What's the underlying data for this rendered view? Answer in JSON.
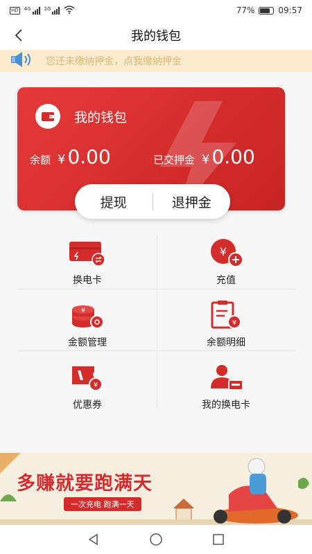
{
  "status_bar": {
    "network_labels": [
      "4G",
      "2G"
    ],
    "battery": "77%",
    "time": "09:57"
  },
  "header": {
    "title": "我的钱包",
    "back_icon": "chevron-left-icon"
  },
  "notice": {
    "text": "您还未缴纳押金，点我缴纳押金",
    "icon": "speaker-icon"
  },
  "wallet": {
    "title": "我的钱包",
    "balance_label": "余额",
    "balance_currency": "¥",
    "balance_value": "0.00",
    "deposit_label": "已交押金",
    "deposit_currency": "¥",
    "deposit_value": "0.00",
    "withdraw_label": "提现",
    "refund_deposit_label": "退押金"
  },
  "menu": {
    "items": [
      {
        "label": "换电卡",
        "icon": "battery-swap-card-icon"
      },
      {
        "label": "充值",
        "icon": "recharge-icon"
      },
      {
        "label": "金额管理",
        "icon": "coin-stack-icon"
      },
      {
        "label": "余额明细",
        "icon": "balance-detail-icon"
      },
      {
        "label": "优惠券",
        "icon": "coupon-icon"
      },
      {
        "label": "我的换电卡",
        "icon": "my-card-icon"
      }
    ]
  },
  "banner": {
    "title": "多赚就要跑满天",
    "subtitle": "一次充电 跑满一天"
  },
  "colors": {
    "brand_red": "#d42b2b",
    "notice_bg": "#fbeccd",
    "notice_text": "#d9b77b"
  }
}
